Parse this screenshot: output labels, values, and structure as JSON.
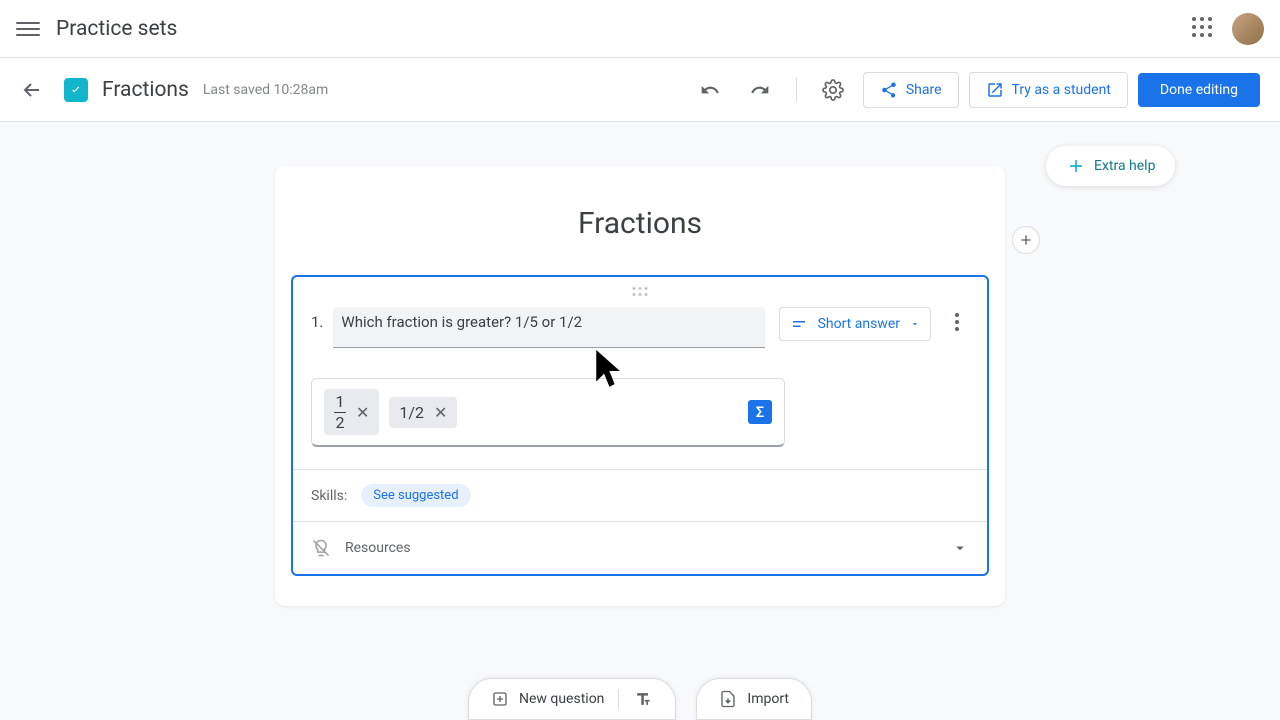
{
  "header": {
    "app_title": "Practice sets"
  },
  "subheader": {
    "doc_title": "Fractions",
    "save_status": "Last saved 10:28am",
    "share_label": "Share",
    "try_label": "Try as a student",
    "done_label": "Done editing"
  },
  "main": {
    "set_title": "Fractions",
    "extra_help_label": "Extra help",
    "question": {
      "number": "1.",
      "text": "Which fraction is greater? 1/5 or 1/2",
      "type_label": "Short answer",
      "answers": {
        "frac_num": "1",
        "frac_den": "2",
        "text_answer": "1/2",
        "sigma": "Σ"
      },
      "skills_label": "Skills:",
      "skills_chip": "See suggested",
      "resources_label": "Resources"
    },
    "bottom": {
      "new_question": "New question",
      "import": "Import"
    }
  }
}
